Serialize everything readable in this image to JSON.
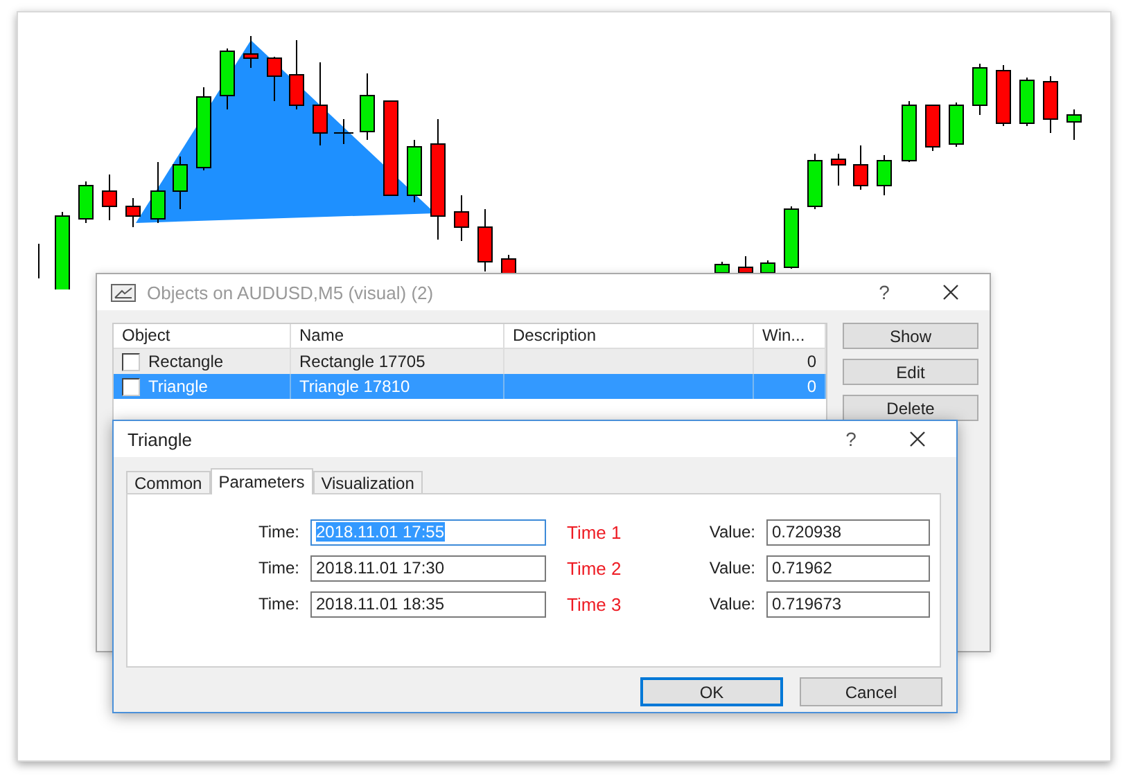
{
  "objects_dialog": {
    "title": "Objects on AUDUSD,M5 (visual) (2)",
    "help": "?",
    "columns": [
      "Object",
      "Name",
      "Description",
      "Win..."
    ],
    "rows": [
      {
        "object": "Rectangle",
        "name": "Rectangle 17705",
        "description": "",
        "window": "0",
        "checked": false,
        "selected": false
      },
      {
        "object": "Triangle",
        "name": "Triangle 17810",
        "description": "",
        "window": "0",
        "checked": false,
        "selected": true
      }
    ],
    "buttons": [
      "Show",
      "Edit",
      "Delete"
    ]
  },
  "triangle_dialog": {
    "title": "Triangle",
    "help": "?",
    "tabs": [
      {
        "label": "Common",
        "selected": false
      },
      {
        "label": "Parameters",
        "selected": true
      },
      {
        "label": "Visualization",
        "selected": false
      }
    ],
    "points": [
      {
        "time_label": "Time:",
        "time": "2018.11.01 17:55",
        "text_selected": true,
        "marker": "Time 1",
        "value_label": "Value:",
        "value": "0.720938"
      },
      {
        "time_label": "Time:",
        "time": "2018.11.01 17:30",
        "text_selected": false,
        "marker": "Time 2",
        "value_label": "Value:",
        "value": "0.71962"
      },
      {
        "time_label": "Time:",
        "time": "2018.11.01 18:35",
        "text_selected": false,
        "marker": "Time 3",
        "value_label": "Value:",
        "value": "0.719673"
      }
    ],
    "buttons": [
      {
        "label": "OK",
        "default": true
      },
      {
        "label": "Cancel",
        "default": false
      }
    ]
  }
}
